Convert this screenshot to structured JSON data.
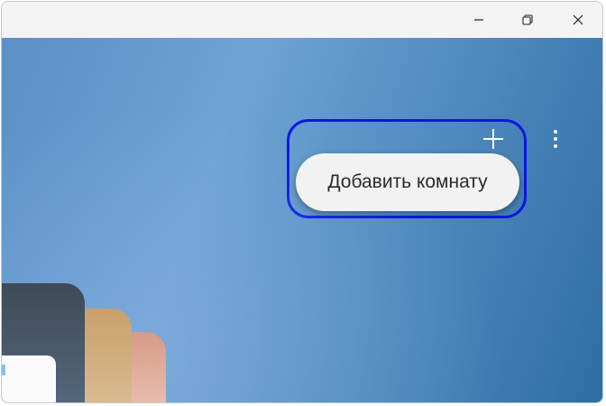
{
  "window": {
    "controls": {
      "minimize_icon": "minimize-icon",
      "maximize_icon": "restore-icon",
      "close_icon": "close-icon"
    }
  },
  "toolbar": {
    "add_icon": "plus-icon",
    "more_icon": "more-vertical-icon"
  },
  "add_room": {
    "label": "Добавить комнату"
  },
  "colors": {
    "highlight_border": "#0a18e6",
    "background_start": "#5b8fc6",
    "background_end": "#2e6ea3",
    "pill_background": "#f2f2f2"
  }
}
